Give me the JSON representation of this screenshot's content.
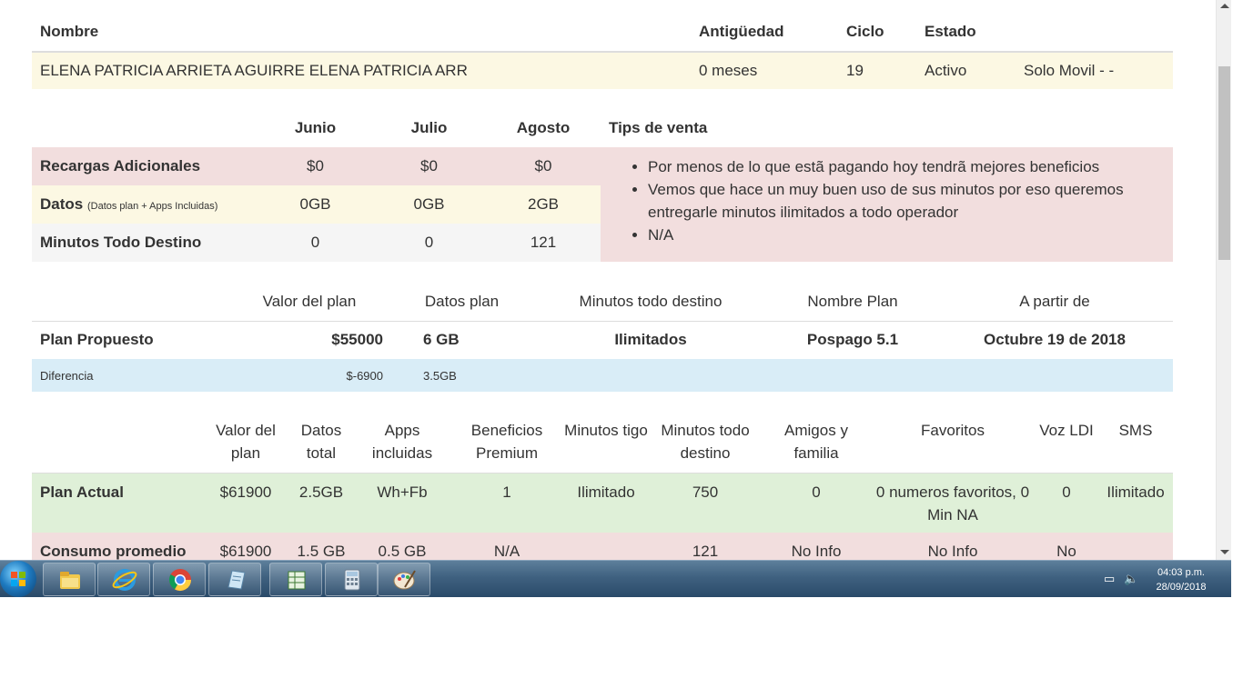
{
  "customer": {
    "headers": [
      "Nombre",
      "Antigüedad",
      "Ciclo",
      "Estado",
      ""
    ],
    "name": "ELENA PATRICIA ARRIETA AGUIRRE ELENA PATRICIA ARR",
    "antiguedad": "0 meses",
    "ciclo": "19",
    "estado": "Activo",
    "tipo": "Solo Movil - -"
  },
  "consumo": {
    "months": [
      "Junio",
      "Julio",
      "Agosto"
    ],
    "tips_header": "Tips de venta",
    "rows": [
      {
        "label": "Recargas Adicionales",
        "note": "",
        "values": [
          "$0",
          "$0",
          "$0"
        ]
      },
      {
        "label": "Datos",
        "note": "(Datos plan + Apps Incluidas)",
        "values": [
          "0GB",
          "0GB",
          "2GB"
        ]
      },
      {
        "label": "Minutos Todo Destino",
        "note": "",
        "values": [
          "0",
          "0",
          "121"
        ]
      }
    ],
    "tips": [
      "Por menos de lo que estã pagando hoy tendrã mejores beneficios",
      "Vemos que hace un muy buen uso de sus minutos por eso queremos entregarle minutos ilimitados a todo operador",
      "N/A"
    ]
  },
  "propuesta": {
    "headers": [
      "Valor del plan",
      "Datos plan",
      "Minutos todo destino",
      "Nombre Plan",
      "A partir de"
    ],
    "label": "Plan Propuesto",
    "valor": "$55000",
    "datos": "6 GB",
    "minutos": "Ilimitados",
    "nombre": "Pospago 5.1",
    "fecha": "Octubre 19 de 2018",
    "diff_label": "Diferencia",
    "diff_valor": "$-6900",
    "diff_datos": "3.5GB"
  },
  "actual": {
    "headers": [
      "Valor del plan",
      "Datos total",
      "Apps incluidas",
      "Beneficios Premium",
      "Minutos tigo",
      "Minutos todo destino",
      "Amigos y familia",
      "Favoritos",
      "Voz LDI",
      "SMS"
    ],
    "rows": [
      {
        "label": "Plan Actual",
        "values": [
          "$61900",
          "2.5GB",
          "Wh+Fb",
          "1",
          "Ilimitado",
          "750",
          "0",
          "0 numeros favoritos, 0 Min NA",
          "0",
          "Ilimitado"
        ]
      },
      {
        "label": "Consumo promedio",
        "values": [
          "$61900",
          "1.5 GB",
          "0.5 GB",
          "N/A",
          "",
          "121",
          "No Info",
          "No Info",
          "No",
          ""
        ]
      }
    ]
  },
  "taskbar": {
    "apps": [
      "file-explorer-icon",
      "internet-explorer-icon",
      "chrome-icon",
      "notes-icon",
      "spreadsheet-icon",
      "calculator-icon",
      "paint-icon"
    ],
    "time": "04:03 p.m.",
    "date": "28/09/2018"
  },
  "colors": {
    "warning": "#fcf8e3",
    "danger": "#f2dede",
    "info": "#d9edf7",
    "success": "#dff0d8"
  }
}
